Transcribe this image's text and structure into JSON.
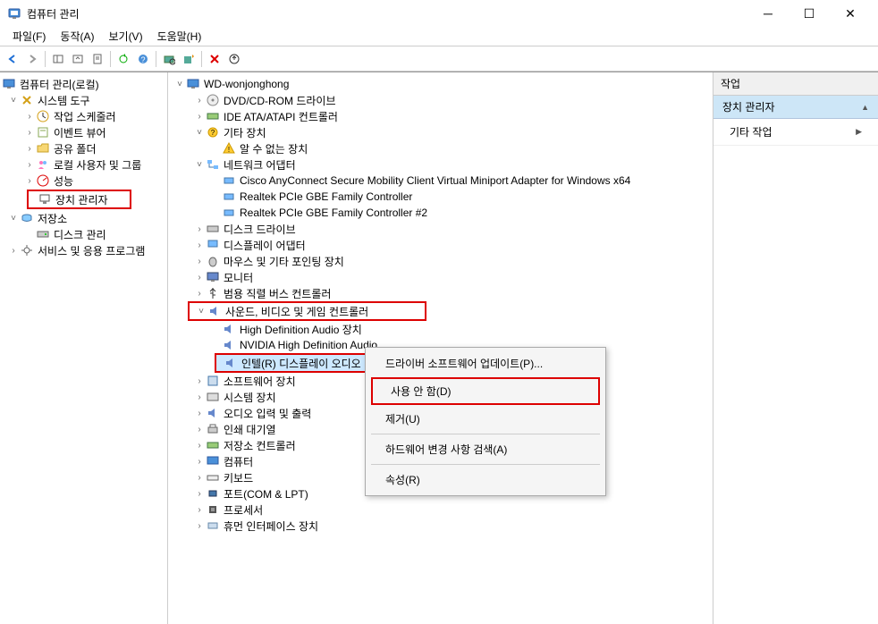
{
  "window": {
    "title": "컴퓨터 관리"
  },
  "menubar": {
    "file": "파일(F)",
    "action": "동작(A)",
    "view": "보기(V)",
    "help": "도움말(H)"
  },
  "left_tree": {
    "root": "컴퓨터 관리(로컬)",
    "system_tools": "시스템 도구",
    "scheduler": "작업 스케줄러",
    "event_viewer": "이벤트 뷰어",
    "shared_folders": "공유 폴더",
    "local_users": "로컬 사용자 및 그룹",
    "performance": "성능",
    "device_manager": "장치 관리자",
    "storage": "저장소",
    "disk_mgmt": "디스크 관리",
    "services_apps": "서비스 및 응용 프로그램"
  },
  "mid_tree": {
    "root": "WD-wonjonghong",
    "dvd": "DVD/CD-ROM 드라이브",
    "ide": "IDE ATA/ATAPI 컨트롤러",
    "other_devices": "기타 장치",
    "unknown_device": "알 수 없는 장치",
    "network_adapters": "네트워크 어댑터",
    "net_cisco": "Cisco AnyConnect Secure Mobility Client Virtual Miniport Adapter for Windows x64",
    "net_realtek1": "Realtek PCIe GBE Family Controller",
    "net_realtek2": "Realtek PCIe GBE Family Controller #2",
    "disk_drives": "디스크 드라이브",
    "display_adapters": "디스플레이 어댑터",
    "mice": "마우스 및 기타 포인팅 장치",
    "monitors": "모니터",
    "usb": "범용 직렬 버스 컨트롤러",
    "sound_video_game": "사운드, 비디오 및 게임 컨트롤러",
    "hd_audio": "High Definition Audio 장치",
    "nvidia_audio": "NVIDIA High Definition Audio",
    "intel_display_audio": "인텔(R) 디스플레이 오디오",
    "software_devices": "소프트웨어 장치",
    "system_devices": "시스템 장치",
    "audio_io": "오디오 입력 및 출력",
    "print_queues": "인쇄 대기열",
    "storage_controllers": "저장소 컨트롤러",
    "computer": "컴퓨터",
    "keyboards": "키보드",
    "ports": "포트(COM & LPT)",
    "processors": "프로세서",
    "hid": "휴먼 인터페이스 장치"
  },
  "right_pane": {
    "header": "작업",
    "section": "장치 관리자",
    "item": "기타 작업"
  },
  "context_menu": {
    "update_driver": "드라이버 소프트웨어 업데이트(P)...",
    "disable": "사용 안 함(D)",
    "uninstall": "제거(U)",
    "scan_hw": "하드웨어 변경 사항 검색(A)",
    "properties": "속성(R)"
  }
}
